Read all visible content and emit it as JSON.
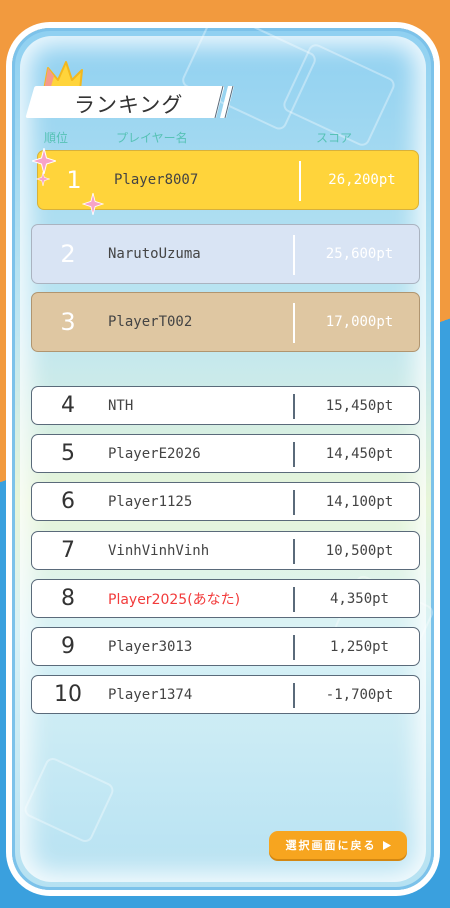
{
  "title": "ランキング",
  "headers": {
    "rank": "順位",
    "player": "プレイヤー名",
    "score": "スコア"
  },
  "rows": [
    {
      "rank": "1",
      "name": "Player8007",
      "score": "26,200pt"
    },
    {
      "rank": "2",
      "name": "NarutoUzuma",
      "score": "25,600pt"
    },
    {
      "rank": "3",
      "name": "PlayerT002",
      "score": "17,000pt"
    },
    {
      "rank": "4",
      "name": "NTH",
      "score": "15,450pt"
    },
    {
      "rank": "5",
      "name": "PlayerE2026",
      "score": "14,450pt"
    },
    {
      "rank": "6",
      "name": "Player1125",
      "score": "14,100pt"
    },
    {
      "rank": "7",
      "name": "VinhVinhVinh",
      "score": "10,500pt"
    },
    {
      "rank": "8",
      "name": "Player2025(あなた)",
      "score": "4,350pt"
    },
    {
      "rank": "9",
      "name": "Player3013",
      "score": "1,250pt"
    },
    {
      "rank": "10",
      "name": "Player1374",
      "score": "-1,700pt"
    }
  ],
  "back_button": {
    "label": "選択画面に戻る",
    "icon": "play-arrow-icon"
  },
  "colors": {
    "gold": "#ffd43b",
    "silver": "#d9e4f4",
    "bronze": "#dfc7a2",
    "me_text": "#f23b3b",
    "button": "#f7a51f",
    "header_text": "#57c2b6"
  }
}
